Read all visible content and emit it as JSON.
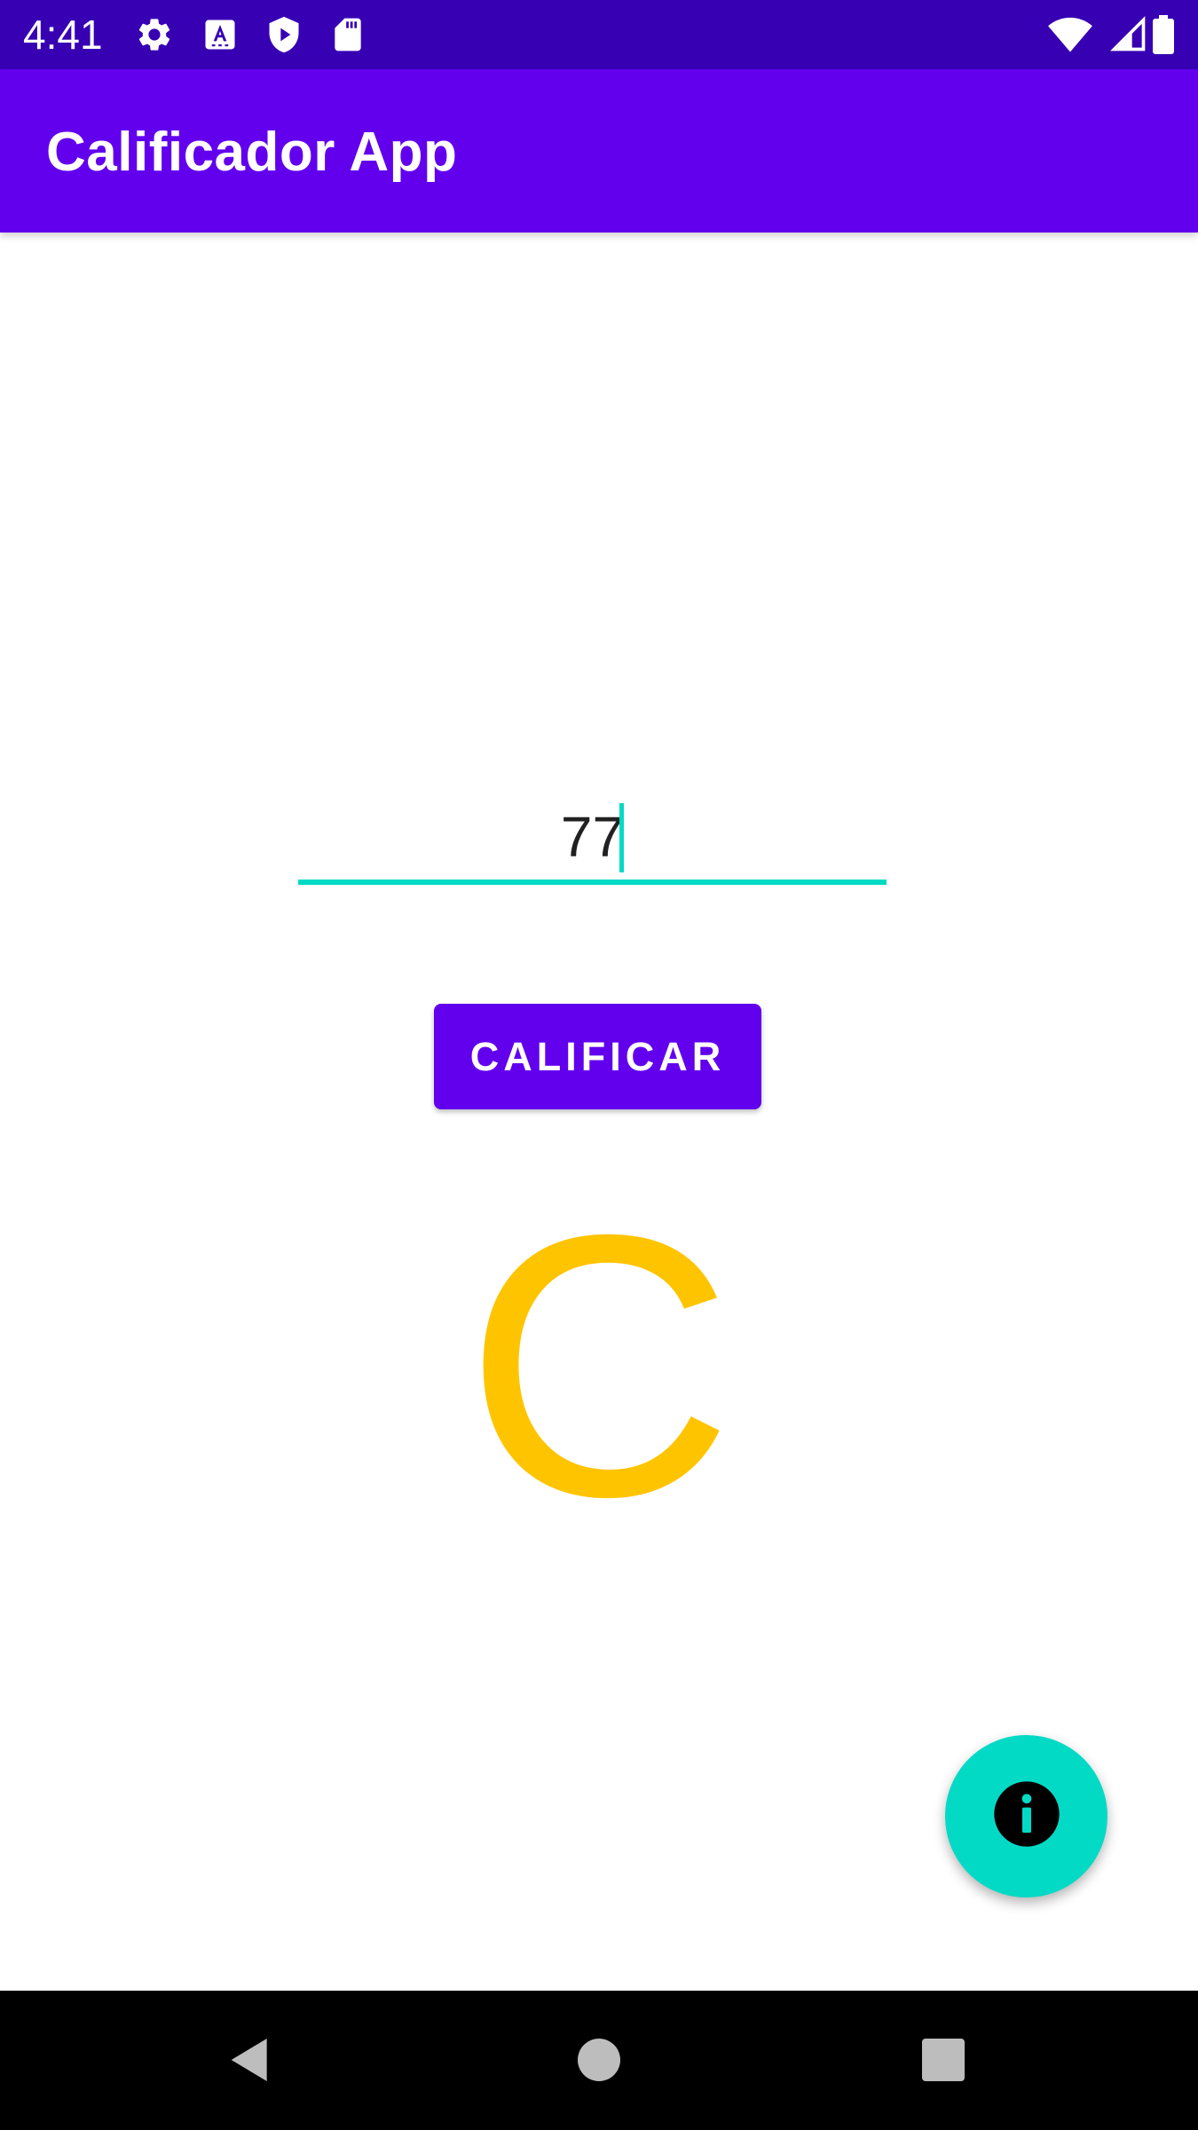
{
  "status_bar": {
    "time": "4:41",
    "left_icons": [
      "settings-icon",
      "keyboard-a-icon",
      "play-protect-icon",
      "sd-card-icon"
    ],
    "right_icons": [
      "wifi-icon",
      "signal-icon",
      "battery-icon"
    ]
  },
  "app_bar": {
    "title": "Calificador App",
    "color": "#6200ee"
  },
  "main": {
    "grade_input": {
      "value": "77",
      "accent_color": "#03dac5"
    },
    "calificar_button": {
      "label": "CALIFICAR",
      "color": "#6200ee"
    },
    "result": {
      "letter": "C",
      "color": "#ffc400"
    },
    "fab": {
      "icon": "info-icon",
      "color": "#03dac5"
    }
  },
  "nav_bar": {
    "buttons": [
      "back-icon",
      "home-icon",
      "recents-icon"
    ]
  }
}
